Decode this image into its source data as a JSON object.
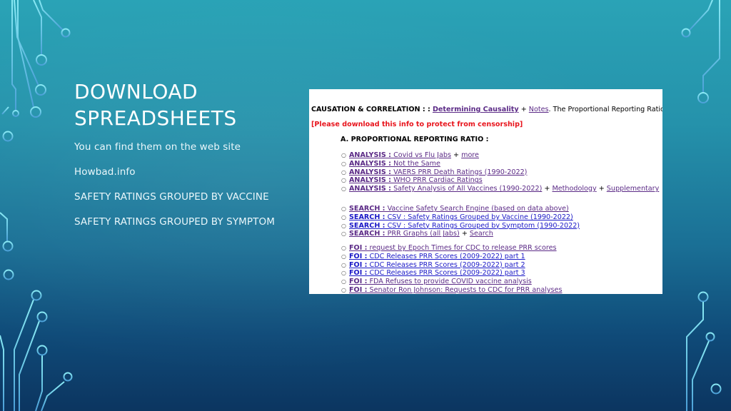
{
  "slide": {
    "title_lines": [
      "DOWNLOAD",
      "SPREADSHEETS"
    ],
    "bullets": [
      "You can find them on the web site",
      "Howbad.info",
      "SAFETY RATINGS GROUPED BY VACCINE",
      "SAFETY RATINGS GROUPED BY SYMPTOM"
    ],
    "colors": {
      "background_top": "#2aa3b6",
      "background_bottom": "#0c3560",
      "circuit_top": "#7fe6f2",
      "circuit_bottom": "#4a9fd6"
    }
  },
  "screenshot": {
    "header": {
      "prefix": "CAUSATION & CORRELATION : :",
      "link1": "Determining Causality",
      "plus": "+",
      "link2": "Notes",
      "suffix": ". The Proportional Reporting Ratio"
    },
    "warning": "[Please download this info to protect from censorship]",
    "section_title": "A. PROPORTIONAL REPORTING RATIO :",
    "bullet_glyph": "○",
    "groups": [
      [
        {
          "label": "ANALYSIS :",
          "text": "Covid vs Flu Jabs",
          "extras": [
            "more"
          ],
          "visited": true
        },
        {
          "label": "ANALYSIS :",
          "text": "Not the Same",
          "extras": [],
          "visited": true
        },
        {
          "label": "ANALYSIS :",
          "text": "VAERS PRR Death Ratings (1990-2022)",
          "extras": [],
          "visited": true
        },
        {
          "label": "ANALYSIS :",
          "text": "WHO PRR Cardiac Ratings",
          "extras": [],
          "visited": true
        },
        {
          "label": "ANALYSIS :",
          "text": "Safety Analysis of All Vaccines (1990-2022)",
          "extras": [
            "Methodology",
            "Supplementary"
          ],
          "visited": true
        }
      ],
      [
        {
          "label": "SEARCH :",
          "text": "Vaccine Safety Search Engine (based on data above)",
          "extras": [],
          "visited": true
        },
        {
          "label": "SEARCH :",
          "text": "CSV : Safety Ratings Grouped by Vaccine (1990-2022)",
          "extras": [],
          "visited": false
        },
        {
          "label": "SEARCH :",
          "text": "CSV : Safety Ratings Grouped by Symptom (1990-2022)",
          "extras": [],
          "visited": false
        },
        {
          "label": "SEARCH :",
          "text": "PRR Graphs (all Jabs)",
          "extras": [
            "Search"
          ],
          "visited": true
        }
      ],
      [
        {
          "label": "FOI :",
          "text": "request by Epoch Times for CDC to release PRR scores",
          "extras": [],
          "visited": true
        },
        {
          "label": "FOI :",
          "text": "CDC Releases PRR Scores (2009-2022) part 1",
          "extras": [],
          "visited": false
        },
        {
          "label": "FOI :",
          "text": "CDC Releases PRR Scores (2009-2022) part 2",
          "extras": [],
          "visited": false
        },
        {
          "label": "FOI :",
          "text": "CDC Releases PRR Scores (2009-2022) part 3",
          "extras": [],
          "visited": false
        },
        {
          "label": "FOI :",
          "text": "FDA Refuses to provide COVID vaccine analysis",
          "extras": [],
          "visited": true
        },
        {
          "label": "FOI :",
          "text": "Senator Ron Johnson: Requests to CDC for PRR analyses",
          "extras": [],
          "visited": true
        }
      ]
    ],
    "colors": {
      "visited_link": "#5b2a86",
      "unvisited_link": "#1a18c7",
      "warning": "#e8141c"
    }
  }
}
